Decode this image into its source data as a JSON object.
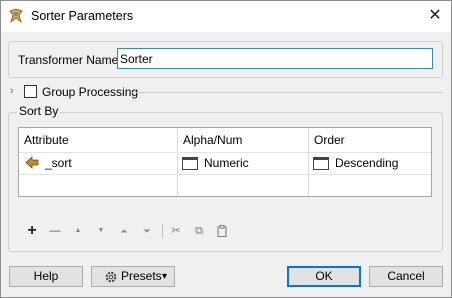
{
  "window": {
    "title": "Sorter Parameters",
    "close_glyph": "✕"
  },
  "transformer": {
    "label": "Transformer Name:",
    "value": "Sorter"
  },
  "group_processing": {
    "label": "Group Processing",
    "checked": false
  },
  "sort_by": {
    "label": "Sort By",
    "columns": [
      "Attribute",
      "Alpha/Num",
      "Order"
    ],
    "rows": [
      {
        "attribute": "_sort",
        "alpha_num": "Numeric",
        "order": "Descending"
      }
    ]
  },
  "toolbar": {
    "add": "+",
    "remove": "—",
    "move_up": "▲",
    "move_down": "▼",
    "move_top": "⏶",
    "move_bottom": "⏷",
    "cut": "✂",
    "copy": "⧉",
    "paste": "📋"
  },
  "footer": {
    "help": "Help",
    "presets": "Presets",
    "presets_caret": "▾",
    "ok": "OK",
    "cancel": "Cancel"
  },
  "colors": {
    "accent": "#0078d7",
    "attribute_icon": "#b8860b"
  }
}
